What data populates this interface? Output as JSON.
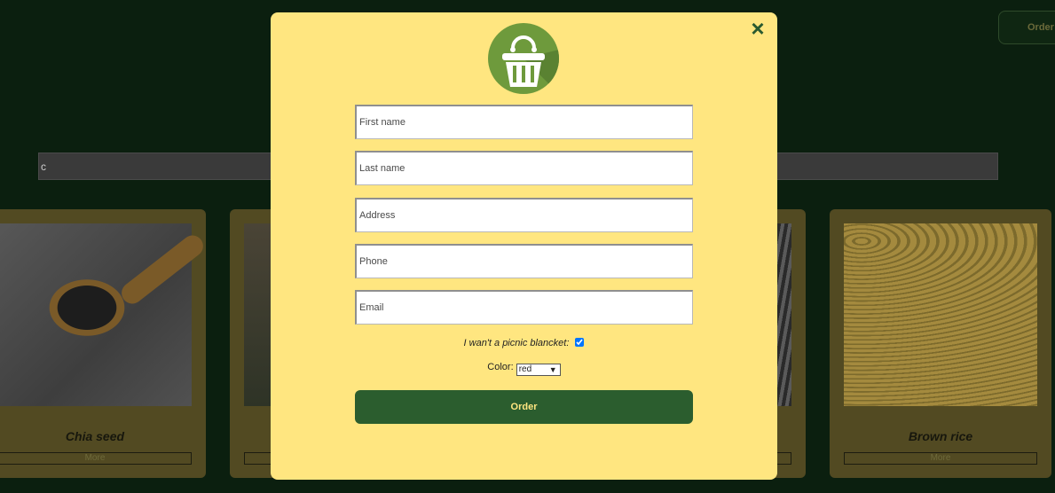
{
  "background": {
    "header_order_label": "Order",
    "search_value": "c",
    "cards": [
      {
        "name": "Chia seed",
        "more": "More"
      },
      {
        "name": "",
        "more": ""
      },
      {
        "name": "",
        "more": ""
      },
      {
        "name": "Brown rice",
        "more": "More"
      }
    ]
  },
  "modal": {
    "close_icon": "×",
    "logo_icon": "basket-icon",
    "fields": {
      "first_name": "First name",
      "last_name": "Last name",
      "address": "Address",
      "phone": "Phone",
      "email": "Email"
    },
    "blanket_label": "I wan't a picnic blancket:",
    "blanket_checked": true,
    "color_label": "Color:",
    "color_value": "red",
    "order_button": "Order"
  },
  "colors": {
    "modal_bg": "#ffe680",
    "accent_green": "#2b5d2e",
    "logo_green": "#6e9a3c"
  }
}
